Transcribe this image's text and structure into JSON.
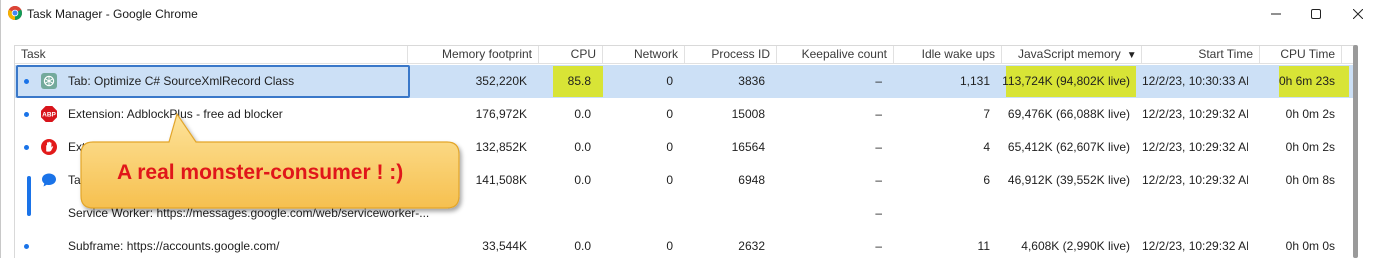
{
  "window": {
    "title": "Task Manager - Google Chrome",
    "controls": [
      "minimize",
      "maximize",
      "close"
    ]
  },
  "columns": [
    {
      "key": "task",
      "label": "Task"
    },
    {
      "key": "memory",
      "label": "Memory footprint"
    },
    {
      "key": "cpu",
      "label": "CPU"
    },
    {
      "key": "network",
      "label": "Network"
    },
    {
      "key": "pid",
      "label": "Process ID"
    },
    {
      "key": "keepalive",
      "label": "Keepalive count"
    },
    {
      "key": "idle",
      "label": "Idle wake ups"
    },
    {
      "key": "js_memory",
      "label": "JavaScript memory",
      "sorted": "descending"
    },
    {
      "key": "start",
      "label": "Start Time"
    },
    {
      "key": "cpu_time",
      "label": "CPU Time"
    }
  ],
  "rows": [
    {
      "task": "Tab: Optimize C# SourceXmlRecord Class",
      "icon": "chatgpt-icon",
      "memory": "352,220K",
      "cpu": "85.8",
      "network": "0",
      "pid": "3836",
      "keepalive": "–",
      "idle": "1,131",
      "js_memory": "113,724K (94,802K live)",
      "start": "12/2/23, 10:30:33 AM",
      "cpu_time": "0h 6m 23s",
      "selected": true,
      "bullet": true
    },
    {
      "task": "Extension: AdblockPlus - free ad blocker",
      "icon": "abp-icon",
      "memory": "176,972K",
      "cpu": "0.0",
      "network": "0",
      "pid": "15008",
      "keepalive": "–",
      "idle": "7",
      "js_memory": "69,476K (66,088K live)",
      "start": "12/2/23, 10:29:32 AM",
      "cpu_time": "0h 0m 2s",
      "bullet": true
    },
    {
      "task": "Exten",
      "icon": "hand-icon",
      "memory": "132,852K",
      "cpu": "0.0",
      "network": "0",
      "pid": "16564",
      "keepalive": "–",
      "idle": "4",
      "js_memory": "65,412K (62,607K live)",
      "start": "12/2/23, 10:29:32 AM",
      "cpu_time": "0h 0m 2s",
      "bullet": true
    },
    {
      "task": "Ta",
      "icon": "messages-icon",
      "memory": "141,508K",
      "cpu": "0.0",
      "network": "0",
      "pid": "6948",
      "keepalive": "–",
      "idle": "6",
      "js_memory": "46,912K (39,552K live)",
      "start": "12/2/23, 10:29:32 AM",
      "cpu_time": "0h 0m 8s"
    },
    {
      "task": "Service Worker: https://messages.google.com/web/serviceworker-...",
      "icon": "",
      "memory": "",
      "cpu": "",
      "network": "",
      "pid": "",
      "keepalive": "–",
      "idle": "",
      "js_memory": "",
      "start": "",
      "cpu_time": ""
    },
    {
      "task": "Subframe: https://accounts.google.com/",
      "icon": "",
      "memory": "33,544K",
      "cpu": "0.0",
      "network": "0",
      "pid": "2632",
      "keepalive": "–",
      "idle": "11",
      "js_memory": "4,608K (2,990K live)",
      "start": "12/2/23, 10:29:32 AM",
      "cpu_time": "0h 0m 0s",
      "bullet": true
    }
  ],
  "callout": {
    "text": "A real monster-consumer ! :)"
  },
  "colors": {
    "selection": "#cce0f6",
    "selection_border": "#3a78c9",
    "highlight": "#d8e436",
    "bullet": "#1a73e8",
    "callout_fill": "#fbd36b",
    "callout_text": "#e0161a"
  }
}
